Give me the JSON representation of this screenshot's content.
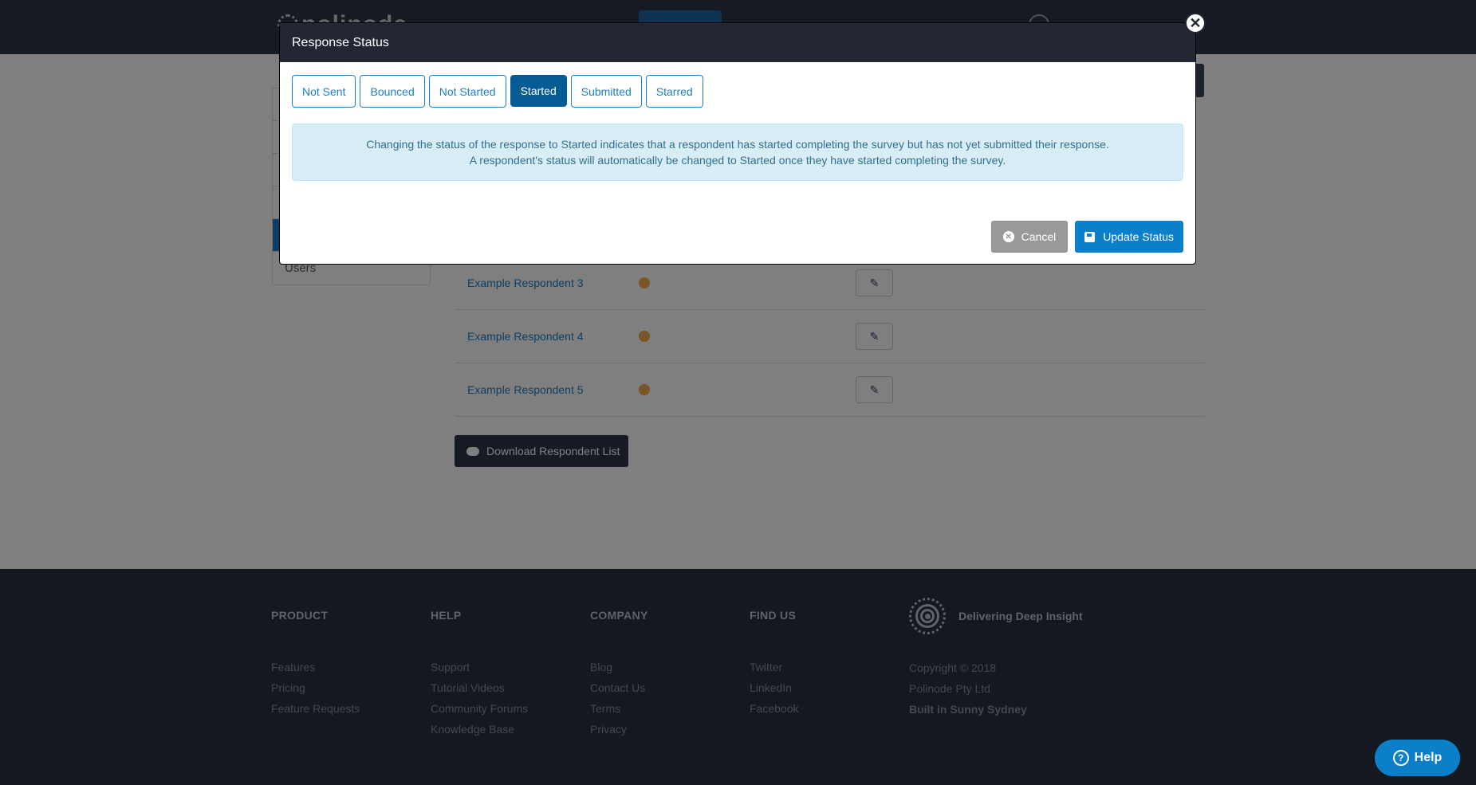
{
  "page": {
    "header": {
      "logo_text": "polinode"
    },
    "sidebar": {
      "items": [
        {
          "label": "",
          "active": false
        },
        {
          "label": "",
          "active": false
        },
        {
          "label": "",
          "active": false
        },
        {
          "label": "",
          "active": true
        },
        {
          "label": "",
          "active": false
        },
        {
          "label": "Users",
          "active": false
        }
      ]
    },
    "respondents": [
      {
        "name": "Example Respondent 3",
        "status_color": "#f0ad4e"
      },
      {
        "name": "Example Respondent 4",
        "status_color": "#f0ad4e"
      },
      {
        "name": "Example Respondent 5",
        "status_color": "#f0ad4e"
      }
    ],
    "download_label": "Download Respondent List"
  },
  "modal": {
    "title": "Response Status",
    "statuses": [
      {
        "label": "Not Sent",
        "active": false
      },
      {
        "label": "Bounced",
        "active": false
      },
      {
        "label": "Not Started",
        "active": false
      },
      {
        "label": "Started",
        "active": true
      },
      {
        "label": "Submitted",
        "active": false
      },
      {
        "label": "Starred",
        "active": false
      }
    ],
    "info_lines": [
      "Changing the status of the response to Started indicates that a respondent has started completing the survey but has not yet submitted their response.",
      "A respondent's status will automatically be changed to Started once they have started completing the survey."
    ],
    "cancel_label": "Cancel",
    "update_label": "Update Status"
  },
  "footer": {
    "columns": [
      {
        "heading": "PRODUCT",
        "links": [
          "Features",
          "Pricing",
          "Feature Requests"
        ]
      },
      {
        "heading": "HELP",
        "links": [
          "Support",
          "Tutorial Videos",
          "Community Forums",
          "Knowledge Base"
        ]
      },
      {
        "heading": "COMPANY",
        "links": [
          "Blog",
          "Contact Us",
          "Terms",
          "Privacy"
        ]
      },
      {
        "heading": "FIND US",
        "links": [
          "Twitter",
          "LinkedIn",
          "Facebook"
        ]
      }
    ],
    "tagline": "Delivering Deep Insight",
    "copyright": "Copyright © 2018",
    "company": "Polinode Pty Ltd",
    "built": "Built in Sunny Sydney"
  },
  "help_label": "Help",
  "colors": {
    "primary": "#1c7fc4",
    "active_status": "#055c94",
    "nav_bg": "#2c3446",
    "footer_bg": "#28303f",
    "info_bg": "#d9edf7",
    "info_text": "#31708f",
    "started_status": "#f0ad4e"
  }
}
